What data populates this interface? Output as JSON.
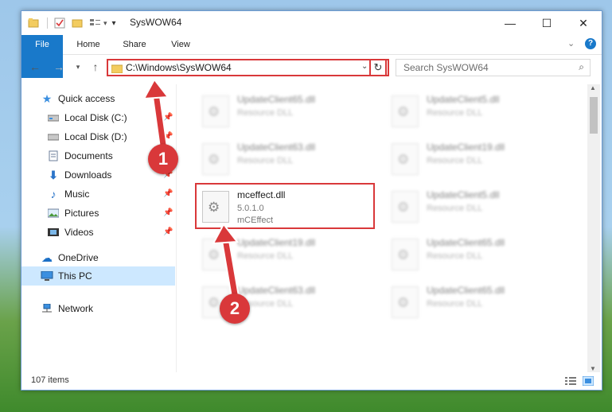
{
  "window": {
    "title": "SysWOW64"
  },
  "ribbon": {
    "tabs": [
      "File",
      "Home",
      "Share",
      "View"
    ]
  },
  "address": {
    "path": "C:\\Windows\\SysWOW64"
  },
  "search": {
    "placeholder": "Search SysWOW64"
  },
  "nav": {
    "items": [
      {
        "label": "Quick access",
        "icon": "star-icon",
        "pinned": false
      },
      {
        "label": "Local Disk (C:)",
        "icon": "drive-icon",
        "pinned": true
      },
      {
        "label": "Local Disk (D:)",
        "icon": "drive-icon",
        "pinned": true
      },
      {
        "label": "Documents",
        "icon": "documents-icon",
        "pinned": true
      },
      {
        "label": "Downloads",
        "icon": "download-icon",
        "pinned": true
      },
      {
        "label": "Music",
        "icon": "music-icon",
        "pinned": true
      },
      {
        "label": "Pictures",
        "icon": "pictures-icon",
        "pinned": true
      },
      {
        "label": "Videos",
        "icon": "videos-icon",
        "pinned": true
      },
      {
        "label": "OneDrive",
        "icon": "cloud-icon",
        "pinned": false
      },
      {
        "label": "This PC",
        "icon": "computer-icon",
        "pinned": false,
        "selected": true
      },
      {
        "label": "Network",
        "icon": "network-icon",
        "pinned": false
      }
    ]
  },
  "files": [
    {
      "name": "UpdateClient65.dll",
      "type": "Resource DLL"
    },
    {
      "name": "UpdateClient5.dll",
      "type": "Resource DLL"
    },
    {
      "name": "UpdateClient63.dll",
      "type": "Resource DLL"
    },
    {
      "name": "UpdateClient19.dll",
      "type": "Resource DLL"
    },
    {
      "name": "mceffect.dll",
      "version": "5.0.1.0",
      "description": "mCEffect"
    },
    {
      "name": "UpdateClient5.dll",
      "type": "Resource DLL"
    },
    {
      "name": "UpdateClient19.dll",
      "type": "Resource DLL"
    },
    {
      "name": "UpdateClient65.dll",
      "type": "Resource DLL"
    },
    {
      "name": "UpdateClient63.dll",
      "type": "Resource DLL"
    },
    {
      "name": "UpdateClient65.dll",
      "type": "Resource DLL"
    }
  ],
  "status": {
    "item_count": "107 items"
  },
  "annotations": {
    "step1": "1",
    "step2": "2",
    "color": "#d9383a"
  }
}
